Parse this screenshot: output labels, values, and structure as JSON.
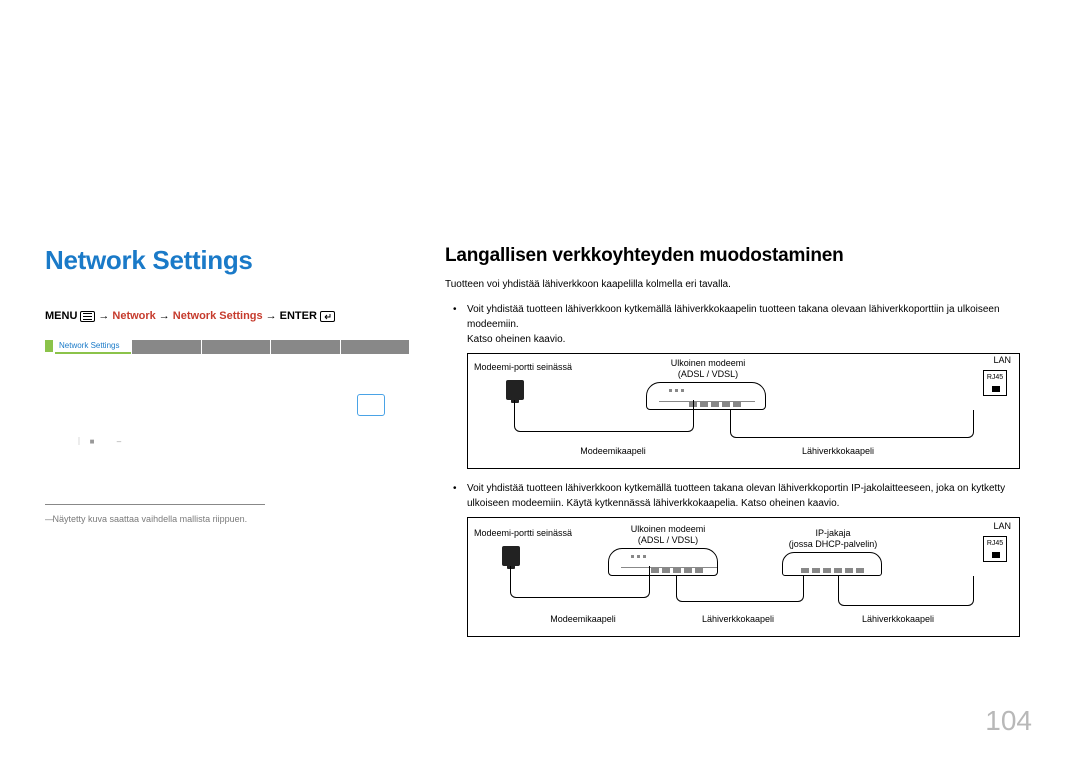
{
  "left": {
    "title": "Network Settings",
    "breadcrumb": {
      "menu": "MENU",
      "network": "Network",
      "network_settings": "Network Settings",
      "enter": "ENTER"
    },
    "scr_tab": "Network Settings",
    "footnote": "Näytetty kuva saattaa vaihdella mallista riippuen."
  },
  "right": {
    "subtitle": "Langallisen verkkoyhteyden muodostaminen",
    "intro": "Tuotteen voi yhdistää lähiverkkoon kaapelilla kolmella eri tavalla.",
    "bullet1": "Voit yhdistää tuotteen lähiverkkoon kytkemällä lähiverkkokaapelin tuotteen takana olevaan lähiverkkoporttiin ja ulkoiseen modeemiin.",
    "bullet1_sub": "Katso oheinen kaavio.",
    "bullet2": "Voit yhdistää tuotteen lähiverkkoon kytkemällä tuotteen takana olevan lähiverkkoportin IP-jakolaitteeseen, joka on kytketty ulkoiseen modeemiin. Käytä kytkennässä lähiverkkokaapelia. Katso oheinen kaavio.",
    "diagram1": {
      "wall": "Modeemi-portti seinässä",
      "modem_line1": "Ulkoinen modeemi",
      "modem_line2": "(ADSL / VDSL)",
      "lan": "LAN",
      "rj45": "RJ45",
      "cable_modem": "Modeemikaapeli",
      "cable_lan": "Lähiverkkokaapeli"
    },
    "diagram2": {
      "wall": "Modeemi-portti seinässä",
      "modem_line1": "Ulkoinen modeemi",
      "modem_line2": "(ADSL / VDSL)",
      "router_line1": "IP-jakaja",
      "router_line2": "(jossa DHCP-palvelin)",
      "lan": "LAN",
      "rj45": "RJ45",
      "cable_modem": "Modeemikaapeli",
      "cable_lan1": "Lähiverkkokaapeli",
      "cable_lan2": "Lähiverkkokaapeli"
    }
  },
  "page_number": "104"
}
